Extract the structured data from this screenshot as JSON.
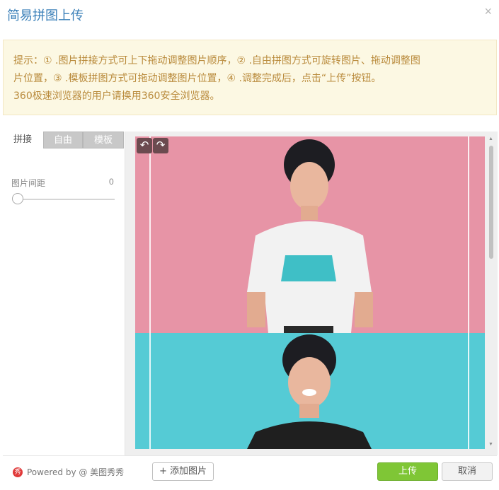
{
  "dialog": {
    "title": "简易拼图上传",
    "close_icon": "close-icon",
    "close_glyph": "×"
  },
  "notice": {
    "line1": "提示：① .图片拼接方式可上下拖动调整图片顺序，② .自由拼图方式可旋转图片、拖动调整图",
    "line2": "片位置，③ .模板拼图方式可拖动调整图片位置，④ .调整完成后，点击“上传”按钮。",
    "line3": "360极速浏览器的用户请换用360安全浏览器。"
  },
  "tabs": [
    {
      "label": "拼接",
      "active": true
    },
    {
      "label": "自由",
      "active": false
    },
    {
      "label": "模板",
      "active": false
    }
  ],
  "spacing": {
    "label": "图片间距",
    "value": "0",
    "slider_fraction": 0
  },
  "canvas": {
    "rotate_left_icon": "rotate-left-icon",
    "rotate_right_icon": "rotate-right-icon",
    "rotate_left_glyph": "↶",
    "rotate_right_glyph": "↷",
    "photos": [
      {
        "description_icon": "photo-pink-background",
        "color": "#e794a6"
      },
      {
        "description_icon": "photo-cyan-background",
        "color": "#55cbd5"
      }
    ]
  },
  "footer": {
    "powered_by": "Powered by @ 美图秀秀",
    "logo_glyph": "秀",
    "add_button": "+ 添加图片",
    "upload_button": "上传",
    "cancel_button": "取消"
  },
  "colors": {
    "title": "#3a7fb8",
    "notice_text": "#b98a3b",
    "upload_green": "#7fc636"
  }
}
